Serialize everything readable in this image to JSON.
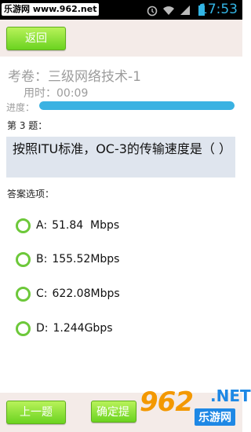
{
  "status_bar": {
    "watermark_text": "乐游网 www.962.net",
    "time": "17:53",
    "icons": [
      "alarm-icon",
      "wifi-icon",
      "signal-icon",
      "battery-icon"
    ]
  },
  "header": {
    "back_label": "返回"
  },
  "exam": {
    "title": "考卷：三级网络技术-1",
    "elapsed": "用时：00:09",
    "progress_label": "进度：",
    "progress_fraction": 1.0
  },
  "question": {
    "number_label": "第 3 题：",
    "text": "按照ITU标准，OC-3的传输速度是（ ）"
  },
  "answers": {
    "label": "答案选项：",
    "options": [
      {
        "letter": "A:",
        "text": "51.84  Mbps"
      },
      {
        "letter": "B:",
        "text": "155.52Mbps"
      },
      {
        "letter": "C:",
        "text": "622.08Mbps"
      },
      {
        "letter": "D:",
        "text": "1.244Gbps"
      }
    ]
  },
  "footer": {
    "prev_label": "上一题",
    "submit_label": "确定提交"
  },
  "site_watermark": {
    "brand": "962",
    "domain": ".NET",
    "name": "乐游网"
  },
  "colors": {
    "accent_green": "#6bd320",
    "progress_blue": "#3ab2e2",
    "header_bg": "#f4ebe8"
  }
}
